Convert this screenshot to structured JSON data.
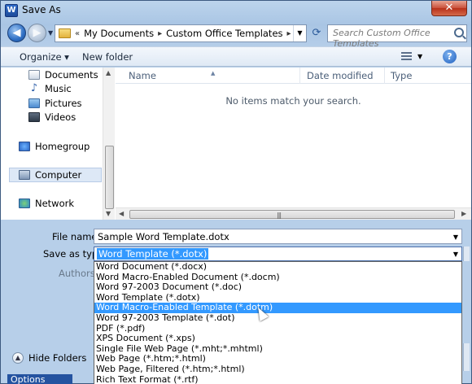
{
  "window": {
    "title": "Save As",
    "app_icon": "W",
    "close_label": "✕"
  },
  "address": {
    "crumbs": [
      "My Documents",
      "Custom Office Templates"
    ]
  },
  "search": {
    "placeholder": "Search Custom Office Templates"
  },
  "toolbar": {
    "organize_label": "Organize ▾",
    "new_folder_label": "New folder",
    "help_label": "?"
  },
  "sidebar": {
    "items": [
      {
        "label": "Documents",
        "icon": "documents-icon"
      },
      {
        "label": "Music",
        "icon": "music-icon"
      },
      {
        "label": "Pictures",
        "icon": "pictures-icon"
      },
      {
        "label": "Videos",
        "icon": "videos-icon"
      },
      {
        "label": "Homegroup",
        "icon": "homegroup-icon"
      },
      {
        "label": "Computer",
        "icon": "computer-icon"
      },
      {
        "label": "Network",
        "icon": "network-icon"
      }
    ]
  },
  "columns": {
    "name": "Name",
    "date": "Date modified",
    "type": "Type"
  },
  "empty_message": "No items match your search.",
  "form": {
    "filename_label": "File name:",
    "filename_value": "Sample Word Template.dotx",
    "savetype_label": "Save as type:",
    "savetype_value": "Word Template (*.dotx)",
    "authors_label": "Authors:"
  },
  "type_options": [
    "Word Document (*.docx)",
    "Word Macro-Enabled Document (*.docm)",
    "Word 97-2003 Document (*.doc)",
    "Word Template (*.dotx)",
    "Word Macro-Enabled Template (*.dotm)",
    "Word 97-2003 Template (*.dot)",
    "PDF (*.pdf)",
    "XPS Document (*.xps)",
    "Single File Web Page (*.mht;*.mhtml)",
    "Web Page (*.htm;*.html)",
    "Web Page, Filtered (*.htm;*.html)",
    "Rich Text Format (*.rtf)"
  ],
  "highlighted_option": "Word Macro-Enabled Template (*.dotm)",
  "hide_folders_label": "Hide Folders",
  "options_label": "Options"
}
